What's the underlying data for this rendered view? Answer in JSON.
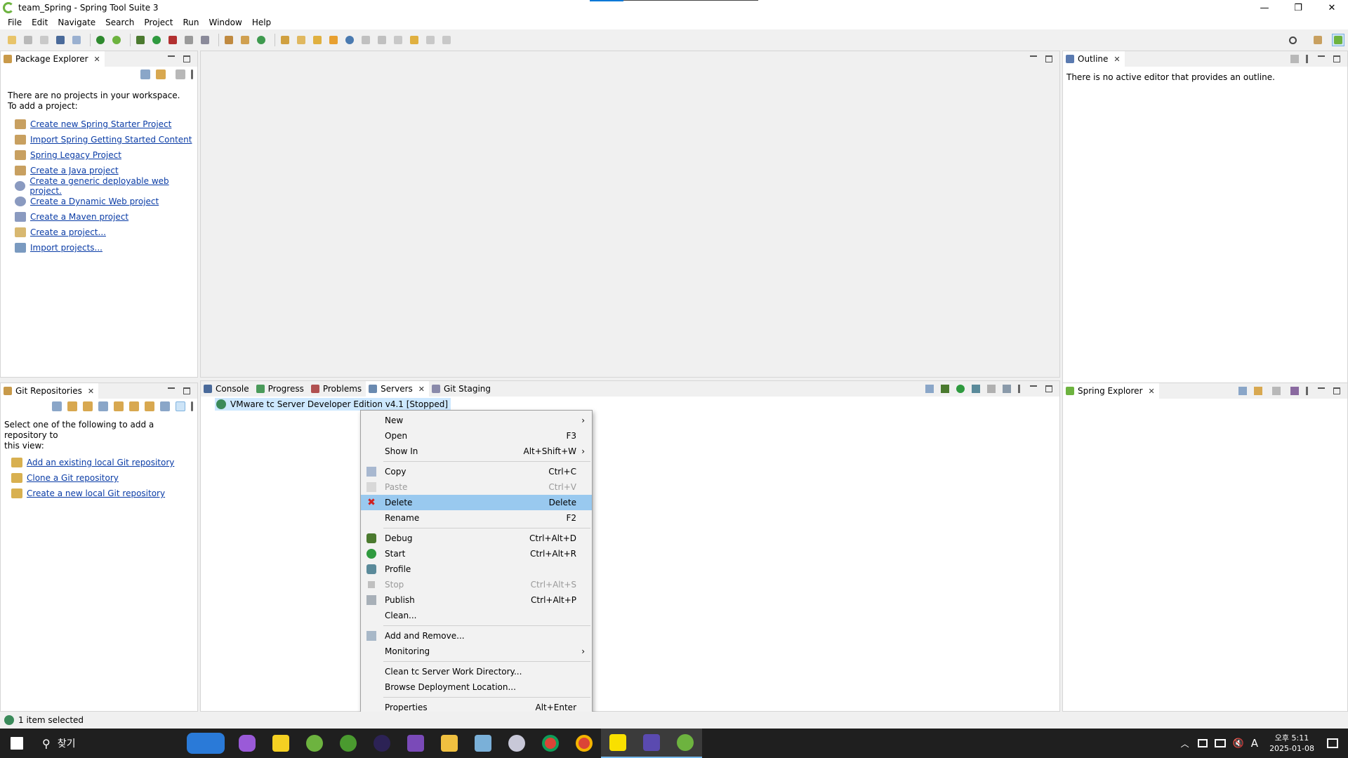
{
  "window": {
    "title": "team_Spring - Spring Tool Suite 3",
    "controls": {
      "minimize": "—",
      "restore": "❐",
      "close": "✕"
    }
  },
  "menubar": [
    "File",
    "Edit",
    "Navigate",
    "Search",
    "Project",
    "Run",
    "Window",
    "Help"
  ],
  "colors": {
    "spring_green": "#6db33f",
    "link": "#0a3ca6",
    "highlight": "#99c9ef",
    "taskbar": "#1f1f1f"
  },
  "package_explorer": {
    "tab_label": "Package Explorer",
    "intro_line1": "There are no projects in your workspace.",
    "intro_line2": "To add a project:",
    "links": [
      {
        "label": "Create new Spring Starter Project",
        "icon": "spring-starter-icon"
      },
      {
        "label": "Import Spring Getting Started Content",
        "icon": "spring-guide-icon"
      },
      {
        "label": "Spring Legacy Project",
        "icon": "spring-legacy-icon"
      },
      {
        "label": "Create a Java project",
        "icon": "java-project-icon"
      },
      {
        "label": "Create a generic deployable web project.",
        "icon": "web-project-icon"
      },
      {
        "label": "Create a Dynamic Web project",
        "icon": "dynamic-web-icon"
      },
      {
        "label": "Create a Maven project",
        "icon": "maven-icon"
      },
      {
        "label": "Create a project...",
        "icon": "new-project-icon"
      },
      {
        "label": "Import projects...",
        "icon": "import-icon"
      }
    ]
  },
  "outline": {
    "tab_label": "Outline",
    "message": "There is no active editor that provides an outline."
  },
  "git_repositories": {
    "tab_label": "Git Repositories",
    "intro_line1": "Select one of the following to add a repository to",
    "intro_line2": "this view:",
    "links": [
      {
        "label": "Add an existing local Git repository",
        "icon": "add-repo-icon"
      },
      {
        "label": "Clone a Git repository",
        "icon": "clone-repo-icon"
      },
      {
        "label": "Create a new local Git repository",
        "icon": "new-repo-icon"
      }
    ]
  },
  "bottom_tabs": [
    {
      "label": "Console",
      "icon": "console-icon"
    },
    {
      "label": "Progress",
      "icon": "progress-icon"
    },
    {
      "label": "Problems",
      "icon": "problems-icon"
    },
    {
      "label": "Servers",
      "icon": "servers-icon",
      "active": true
    },
    {
      "label": "Git Staging",
      "icon": "git-staging-icon"
    }
  ],
  "servers": {
    "entry": "VMware tc Server Developer Edition v4.1  [Stopped]"
  },
  "spring_explorer": {
    "tab_label": "Spring Explorer"
  },
  "context_menu": {
    "items": [
      {
        "label": "New",
        "shortcut": "",
        "submenu": true
      },
      {
        "label": "Open",
        "shortcut": "F3"
      },
      {
        "label": "Show In",
        "shortcut": "Alt+Shift+W",
        "submenu": true
      },
      {
        "sep": true
      },
      {
        "label": "Copy",
        "shortcut": "Ctrl+C",
        "icon": "copy-icon"
      },
      {
        "label": "Paste",
        "shortcut": "Ctrl+V",
        "icon": "paste-icon",
        "disabled": true
      },
      {
        "label": "Delete",
        "shortcut": "Delete",
        "icon": "delete-icon",
        "highlighted": true
      },
      {
        "label": "Rename",
        "shortcut": "F2"
      },
      {
        "sep": true
      },
      {
        "label": "Debug",
        "shortcut": "Ctrl+Alt+D",
        "icon": "debug-icon"
      },
      {
        "label": "Start",
        "shortcut": "Ctrl+Alt+R",
        "icon": "start-icon"
      },
      {
        "label": "Profile",
        "shortcut": "",
        "icon": "profile-icon"
      },
      {
        "label": "Stop",
        "shortcut": "Ctrl+Alt+S",
        "icon": "stop-icon",
        "disabled": true
      },
      {
        "label": "Publish",
        "shortcut": "Ctrl+Alt+P",
        "icon": "publish-icon"
      },
      {
        "label": "Clean...",
        "shortcut": ""
      },
      {
        "sep": true
      },
      {
        "label": "Add and Remove...",
        "shortcut": "",
        "icon": "add-remove-icon"
      },
      {
        "label": "Monitoring",
        "shortcut": "",
        "submenu": true
      },
      {
        "sep": true
      },
      {
        "label": "Clean tc Server Work Directory...",
        "shortcut": ""
      },
      {
        "label": "Browse Deployment Location...",
        "shortcut": ""
      },
      {
        "sep": true
      },
      {
        "label": "Properties",
        "shortcut": "Alt+Enter"
      }
    ]
  },
  "statusbar": {
    "text": "1 item selected"
  },
  "taskbar": {
    "search_label": "찾기",
    "time": "오후 5:11",
    "date": "2025-01-08",
    "ime": "A"
  }
}
